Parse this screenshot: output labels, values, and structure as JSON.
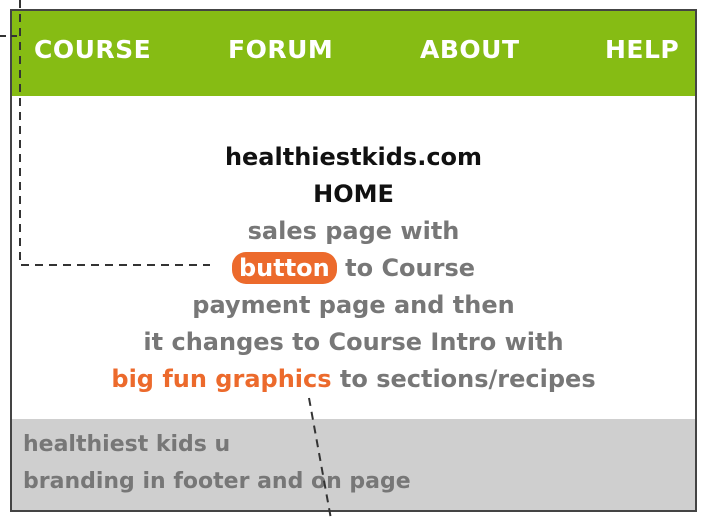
{
  "nav": {
    "items": [
      "COURSE",
      "FORUM",
      "ABOUT",
      "HELP"
    ]
  },
  "main": {
    "site": "healthiestkids.com",
    "page": "HOME",
    "line1": "sales page with",
    "button_label": "button",
    "line2_rest": " to Course",
    "line3": "payment page and then",
    "line4": "it changes to Course Intro with",
    "graphics_label": "big fun graphics",
    "line5_rest": " to sections/recipes"
  },
  "footer": {
    "line1": "healthiest kids u",
    "line2": "branding in footer and on page"
  },
  "colors": {
    "nav_bg": "#86bc14",
    "accent": "#ec6a2c",
    "footer_bg": "#cfcfcf",
    "text_gray": "#777777"
  }
}
